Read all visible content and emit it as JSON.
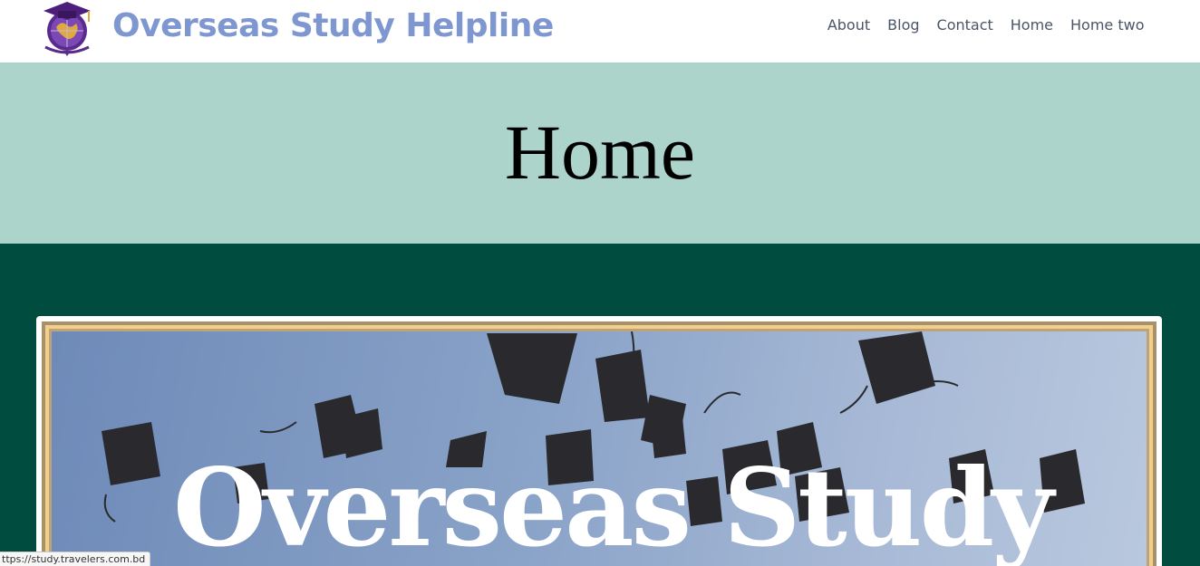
{
  "header": {
    "site_title": "Overseas Study Helpline",
    "logo_icon": "graduation-globe-logo",
    "nav": [
      {
        "label": "About"
      },
      {
        "label": "Blog"
      },
      {
        "label": "Contact"
      },
      {
        "label": "Home"
      },
      {
        "label": "Home two"
      }
    ]
  },
  "banner": {
    "title": "Home"
  },
  "hero": {
    "text": "Overseas Study"
  },
  "status_bar": {
    "url": "ttps://study.travelers.com.bd"
  },
  "colors": {
    "title_blue": "#7f97d0",
    "banner_bg": "#acd4cb",
    "page_bg": "#004d3f"
  }
}
